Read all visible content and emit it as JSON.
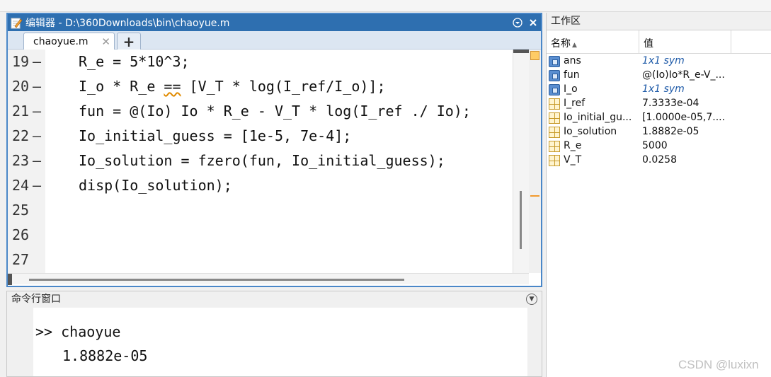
{
  "editor": {
    "title": "编辑器 - D:\\360Downloads\\bin\\chaoyue.m",
    "tab_label": "chaoyue.m",
    "tab_close": "✕",
    "add_tab": "+",
    "lines": [
      {
        "num": "19",
        "dash": "—",
        "code": "R_e = 5*10^3;"
      },
      {
        "num": "20",
        "dash": "—",
        "code_pre": "I_o * R_e ",
        "code_warn": "==",
        "code_post": " [V_T * log(I_ref/I_o)];"
      },
      {
        "num": "21",
        "dash": "—",
        "code": "fun = @(Io) Io * R_e - V_T * log(I_ref ./ Io);"
      },
      {
        "num": "22",
        "dash": "—",
        "code": "Io_initial_guess = [1e-5, 7e-4];"
      },
      {
        "num": "23",
        "dash": "—",
        "code": "Io_solution = fzero(fun, Io_initial_guess);"
      },
      {
        "num": "24",
        "dash": "—",
        "code": "disp(Io_solution);"
      },
      {
        "num": "25",
        "dash": "",
        "code": ""
      },
      {
        "num": "26",
        "dash": "",
        "code": ""
      },
      {
        "num": "27",
        "dash": "",
        "code": ""
      }
    ]
  },
  "command_window": {
    "title": "命令行窗口",
    "prompt_line": ">> chaoyue",
    "output_line": "1.8882e-05"
  },
  "workspace": {
    "title": "工作区",
    "col_name": "名称",
    "col_value": "值",
    "vars": [
      {
        "name": "ans",
        "value": "1x1 sym",
        "kind": "sym"
      },
      {
        "name": "fun",
        "value": "@(Io)Io*R_e-V_...",
        "kind": "sym"
      },
      {
        "name": "I_o",
        "value": "1x1 sym",
        "kind": "sym"
      },
      {
        "name": "I_ref",
        "value": "7.3333e-04",
        "kind": "grid"
      },
      {
        "name": "Io_initial_gu...",
        "value": "[1.0000e-05,7....",
        "kind": "grid"
      },
      {
        "name": "Io_solution",
        "value": "1.8882e-05",
        "kind": "grid"
      },
      {
        "name": "R_e",
        "value": "5000",
        "kind": "grid"
      },
      {
        "name": "V_T",
        "value": "0.0258",
        "kind": "grid"
      }
    ]
  },
  "watermark": "CSDN @luxixn"
}
